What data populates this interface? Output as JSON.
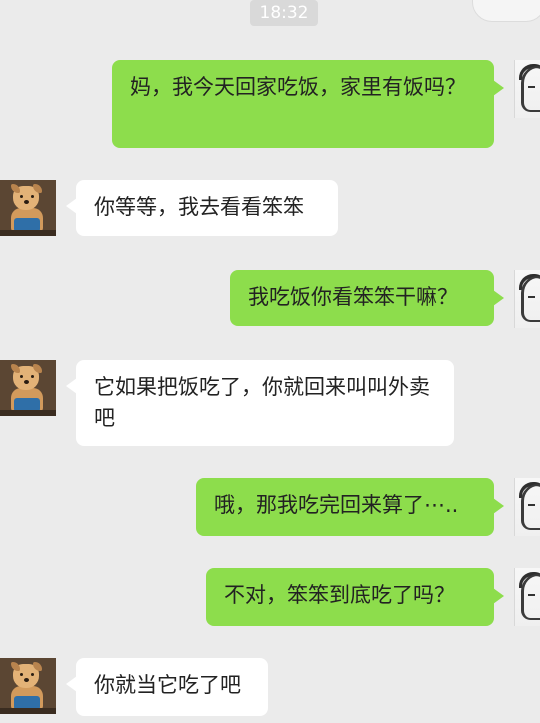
{
  "chat": {
    "timestamp": "18:32",
    "messages": [
      {
        "from": "me",
        "text": "妈，我今天回家吃饭，家里有饭吗？"
      },
      {
        "from": "friend",
        "text": "你等等，我去看看笨笨"
      },
      {
        "from": "me",
        "text": "我吃饭你看笨笨干嘛？"
      },
      {
        "from": "friend",
        "text": "它如果把饭吃了，你就回来叫叫外卖吧"
      },
      {
        "from": "me",
        "text": "哦，那我吃完回来算了⋯.."
      },
      {
        "from": "me",
        "text": "不对，笨笨到底吃了吗？"
      },
      {
        "from": "friend",
        "text": "你就当它吃了吧"
      }
    ]
  },
  "colors": {
    "background": "#ebebeb",
    "outgoing_bubble": "#8ddd4c",
    "incoming_bubble": "#ffffff",
    "timestamp_bg": "#d9d9d9"
  }
}
